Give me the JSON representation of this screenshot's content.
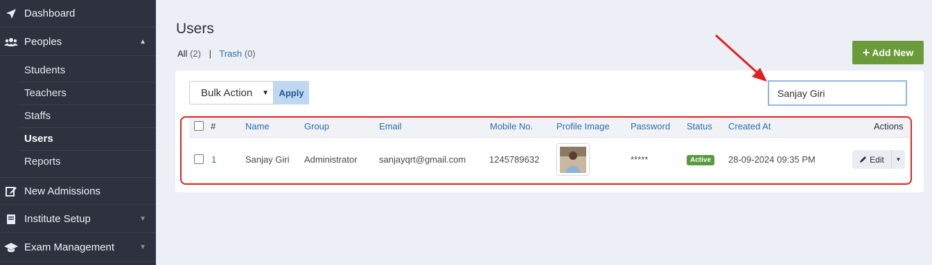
{
  "sidebar": {
    "items": [
      {
        "label": "Dashboard",
        "icon": "paper-plane-icon"
      },
      {
        "label": "Peoples",
        "icon": "users-icon",
        "expanded": true
      },
      {
        "label": "New Admissions",
        "icon": "edit-icon"
      },
      {
        "label": "Institute Setup",
        "icon": "book-icon"
      },
      {
        "label": "Exam Management",
        "icon": "graduation-cap-icon"
      }
    ],
    "peoples_children": [
      "Students",
      "Teachers",
      "Staffs",
      "Users",
      "Reports"
    ],
    "active_child": "Users"
  },
  "page": {
    "title": "Users",
    "filter_all": "All",
    "filter_all_count": "(2)",
    "filter_trash": "Trash",
    "filter_trash_count": "(0)",
    "separator": "|",
    "add_button": "Add New"
  },
  "toolbar": {
    "bulk_action": "Bulk Action",
    "apply": "Apply",
    "search_value": "Sanjay Giri"
  },
  "table": {
    "columns": [
      "#",
      "Name",
      "Group",
      "Email",
      "Mobile No.",
      "Profile Image",
      "Password",
      "Status",
      "Created At",
      "Actions"
    ],
    "rows": [
      {
        "index": "1",
        "name": "Sanjay Giri",
        "group": "Administrator",
        "email": "sanjayqrt@gmail.com",
        "mobile": "1245789632",
        "password": "*****",
        "status": "Active",
        "created_at": "28-09-2024 09:35 PM",
        "edit_label": "Edit"
      }
    ]
  },
  "colors": {
    "sidebar_bg": "#2d323e",
    "accent_green": "#6a9a3a",
    "link_blue": "#2d6cae",
    "highlight_red": "#e02020"
  }
}
